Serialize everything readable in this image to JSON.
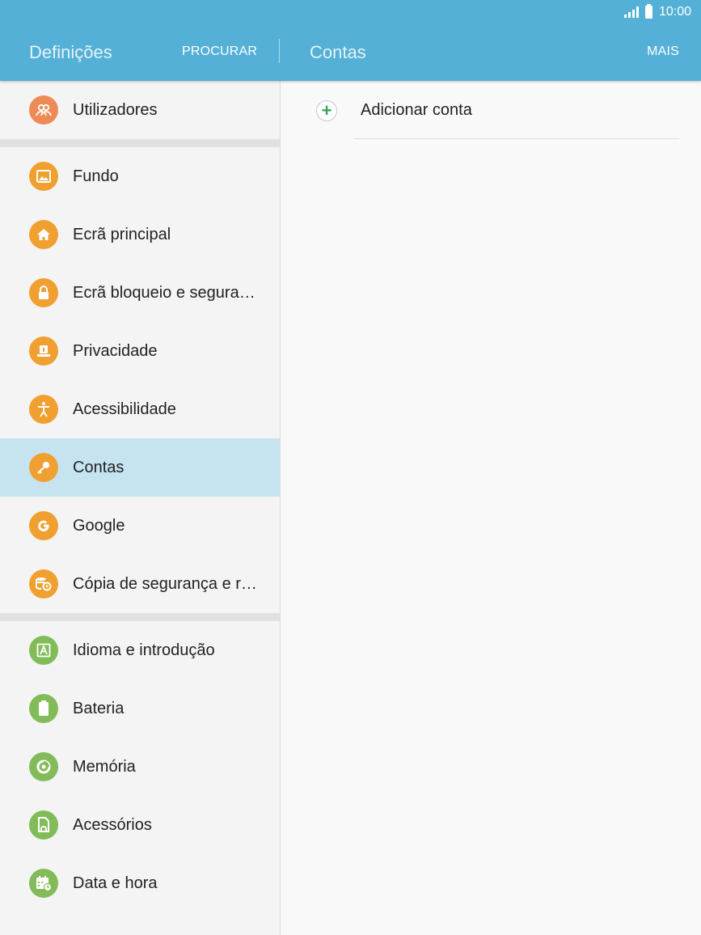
{
  "status_bar": {
    "time": "10:00"
  },
  "header": {
    "title": "Definições",
    "search_label": "PROCURAR",
    "detail_title": "Contas",
    "more_label": "MAIS"
  },
  "sidebar": {
    "groups": [
      [
        {
          "label": "Utilizadores",
          "icon": "users-icon",
          "color": "#ee8a55"
        }
      ],
      [
        {
          "label": "Fundo",
          "icon": "wallpaper-icon",
          "color": "#f0a030"
        },
        {
          "label": "Ecrã principal",
          "icon": "home-icon",
          "color": "#f0a030"
        },
        {
          "label": "Ecrã bloqueio e segura…",
          "icon": "lock-icon",
          "color": "#f0a030"
        },
        {
          "label": "Privacidade",
          "icon": "privacy-icon",
          "color": "#f0a030"
        },
        {
          "label": "Acessibilidade",
          "icon": "accessibility-icon",
          "color": "#f0a030"
        },
        {
          "label": "Contas",
          "icon": "key-icon",
          "color": "#f0a030",
          "active": true
        },
        {
          "label": "Google",
          "icon": "google-icon",
          "color": "#f0a030"
        },
        {
          "label": "Cópia de segurança e r…",
          "icon": "backup-icon",
          "color": "#f0a030"
        }
      ],
      [
        {
          "label": "Idioma e introdução",
          "icon": "language-icon",
          "color": "#82bc58"
        },
        {
          "label": "Bateria",
          "icon": "battery-icon",
          "color": "#82bc58"
        },
        {
          "label": "Memória",
          "icon": "memory-icon",
          "color": "#82bc58"
        },
        {
          "label": "Acessórios",
          "icon": "accessories-icon",
          "color": "#82bc58"
        },
        {
          "label": "Data e hora",
          "icon": "calendar-icon",
          "color": "#82bc58"
        }
      ]
    ]
  },
  "main": {
    "add_account_label": "Adicionar conta"
  },
  "colors": {
    "header": "#54b0d6",
    "active_row": "#c5e4ef",
    "plus": "#3aa35a"
  }
}
